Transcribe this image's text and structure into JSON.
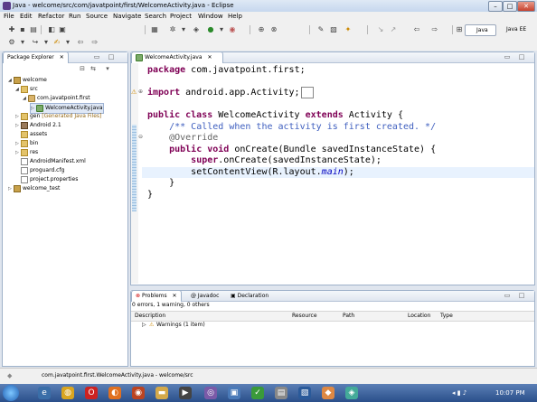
{
  "window": {
    "title": "Java - welcome/src/com/javatpoint/first/WelcomeActivity.java - Eclipse"
  },
  "menu": [
    "File",
    "Edit",
    "Refactor",
    "Run",
    "Source",
    "Navigate",
    "Search",
    "Project",
    "Window",
    "Help"
  ],
  "perspectives": {
    "java": "Java",
    "javaee": "Java EE"
  },
  "package_explorer": {
    "tab": "Package Explorer",
    "tree": [
      {
        "label": "welcome",
        "icon": "project-icon"
      },
      {
        "label": "src",
        "icon": "folder-icon"
      },
      {
        "label": "com.javatpoint.first",
        "icon": "package-icon"
      },
      {
        "label": "WelcomeActivity.java",
        "icon": "java-file-icon"
      },
      {
        "label": "gen",
        "suffix": "[Generated Java Files]",
        "icon": "folder-icon"
      },
      {
        "label": "Android 2.1",
        "icon": "library-icon"
      },
      {
        "label": "assets",
        "icon": "folder-icon"
      },
      {
        "label": "bin",
        "icon": "folder-icon"
      },
      {
        "label": "res",
        "icon": "folder-icon"
      },
      {
        "label": "AndroidManifest.xml",
        "icon": "xml-file-icon"
      },
      {
        "label": "proguard.cfg",
        "icon": "file-icon"
      },
      {
        "label": "project.properties",
        "icon": "file-icon"
      },
      {
        "label": "welcome_test",
        "icon": "project-icon"
      }
    ]
  },
  "editor": {
    "tab": "WelcomeActivity.java",
    "lines": {
      "l1_kw": "package",
      "l1_rest": " com.javatpoint.first;",
      "l2_kw": "import",
      "l2_rest": " android.app.Activity;",
      "l3_kw1": "public class",
      "l3_mid": " WelcomeActivity ",
      "l3_kw2": "extends",
      "l3_rest": " Activity {",
      "l4_comment": "/** Called when the activity is first created. */",
      "l5_annot": "@Override",
      "l6_kw": "public void",
      "l6_rest": " onCreate(Bundle savedInstanceState) {",
      "l7_kw": "super",
      "l7_rest": ".onCreate(savedInstanceState);",
      "l8_pre": "setContentView(R.layout.",
      "l8_it": "main",
      "l8_post": ");",
      "l9": "}",
      "l10": "}"
    }
  },
  "bottom_panel": {
    "tabs": [
      "Problems",
      "Javadoc",
      "Declaration"
    ],
    "summary": "0 errors, 1 warning, 0 others",
    "columns": [
      "Description",
      "Resource",
      "Path",
      "Location",
      "Type"
    ],
    "rows": [
      {
        "description": "Warnings (1 item)"
      }
    ]
  },
  "status": {
    "text": "com.javatpoint.first.WelcomeActivity.java - welcome/src"
  },
  "taskbar": {
    "clock": "10:07 PM"
  }
}
